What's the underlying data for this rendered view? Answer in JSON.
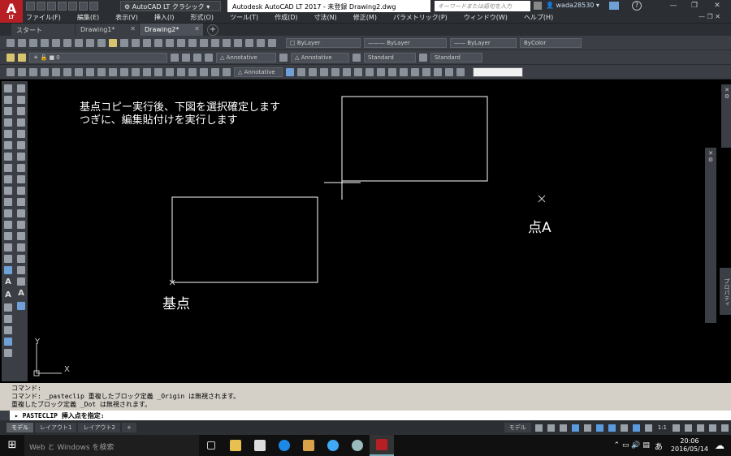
{
  "app": {
    "logo_main": "A",
    "logo_sub": "LT",
    "title": "Autodesk AutoCAD LT 2017 - 未登録    Drawing2.dwg",
    "workspace": "AutoCAD LT クラシック",
    "search_placeholder": "キーワードまたは語句を入力",
    "user": "wada28530"
  },
  "window_controls": {
    "minimize": "—",
    "restore": "❐",
    "close": "✕"
  },
  "menu": [
    "ファイル(F)",
    "編集(E)",
    "表示(V)",
    "挿入(I)",
    "形式(O)",
    "ツール(T)",
    "作成(D)",
    "寸法(N)",
    "修正(M)",
    "パラメトリック(P)",
    "ウィンドウ(W)",
    "ヘルプ(H)"
  ],
  "tabs": [
    {
      "label": "スタート",
      "closable": false
    },
    {
      "label": "Drawing1*",
      "closable": true
    },
    {
      "label": "Drawing2*",
      "closable": true,
      "active": true
    }
  ],
  "tab_add": "+",
  "properties": {
    "layer_combo": "ByLayer",
    "linetype_combo": "ByLayer",
    "lineweight_combo": "ByLayer",
    "color_combo": "ByColor",
    "current_layer": "0",
    "annotative_text": "Annotative",
    "annotative_dim": "Annotative",
    "table_style": "Standard",
    "mleader_style": "Standard",
    "annotative_mleader": "Annotative"
  },
  "canvas": {
    "note_line1": "基点コピー実行後、下図を選択確定します",
    "note_line2": "つぎに、編集貼付けを実行します",
    "label_base": "基点",
    "label_point_a": "点A",
    "ucs_x": "X",
    "ucs_y": "Y"
  },
  "side_text_tool": "A",
  "palette_labels": {
    "properties": "プロパティ"
  },
  "command": {
    "history": [
      "コマンド:",
      "コマンド:  _pasteclip 重複したブロック定義 _Origin  は無視されます。",
      "重複したブロック定義 _Dot  は無視されます。"
    ],
    "prompt": "PASTECLIP 挿入点を指定:"
  },
  "layout_tabs": [
    "モデル",
    "レイアウト1",
    "レイアウト2"
  ],
  "layout_add": "+",
  "status": {
    "model_label": "モデル",
    "scale": "1:1"
  },
  "taskbar": {
    "search_placeholder": "Web と Windows を検索",
    "ime": "あ",
    "time": "20:06",
    "date": "2016/05/14"
  },
  "colors": {
    "accent_red": "#b81f24",
    "dark_ui": "#2b2e33",
    "panel": "#3b3f45",
    "canvas": "#000000",
    "drawing_line": "#ffffff"
  }
}
